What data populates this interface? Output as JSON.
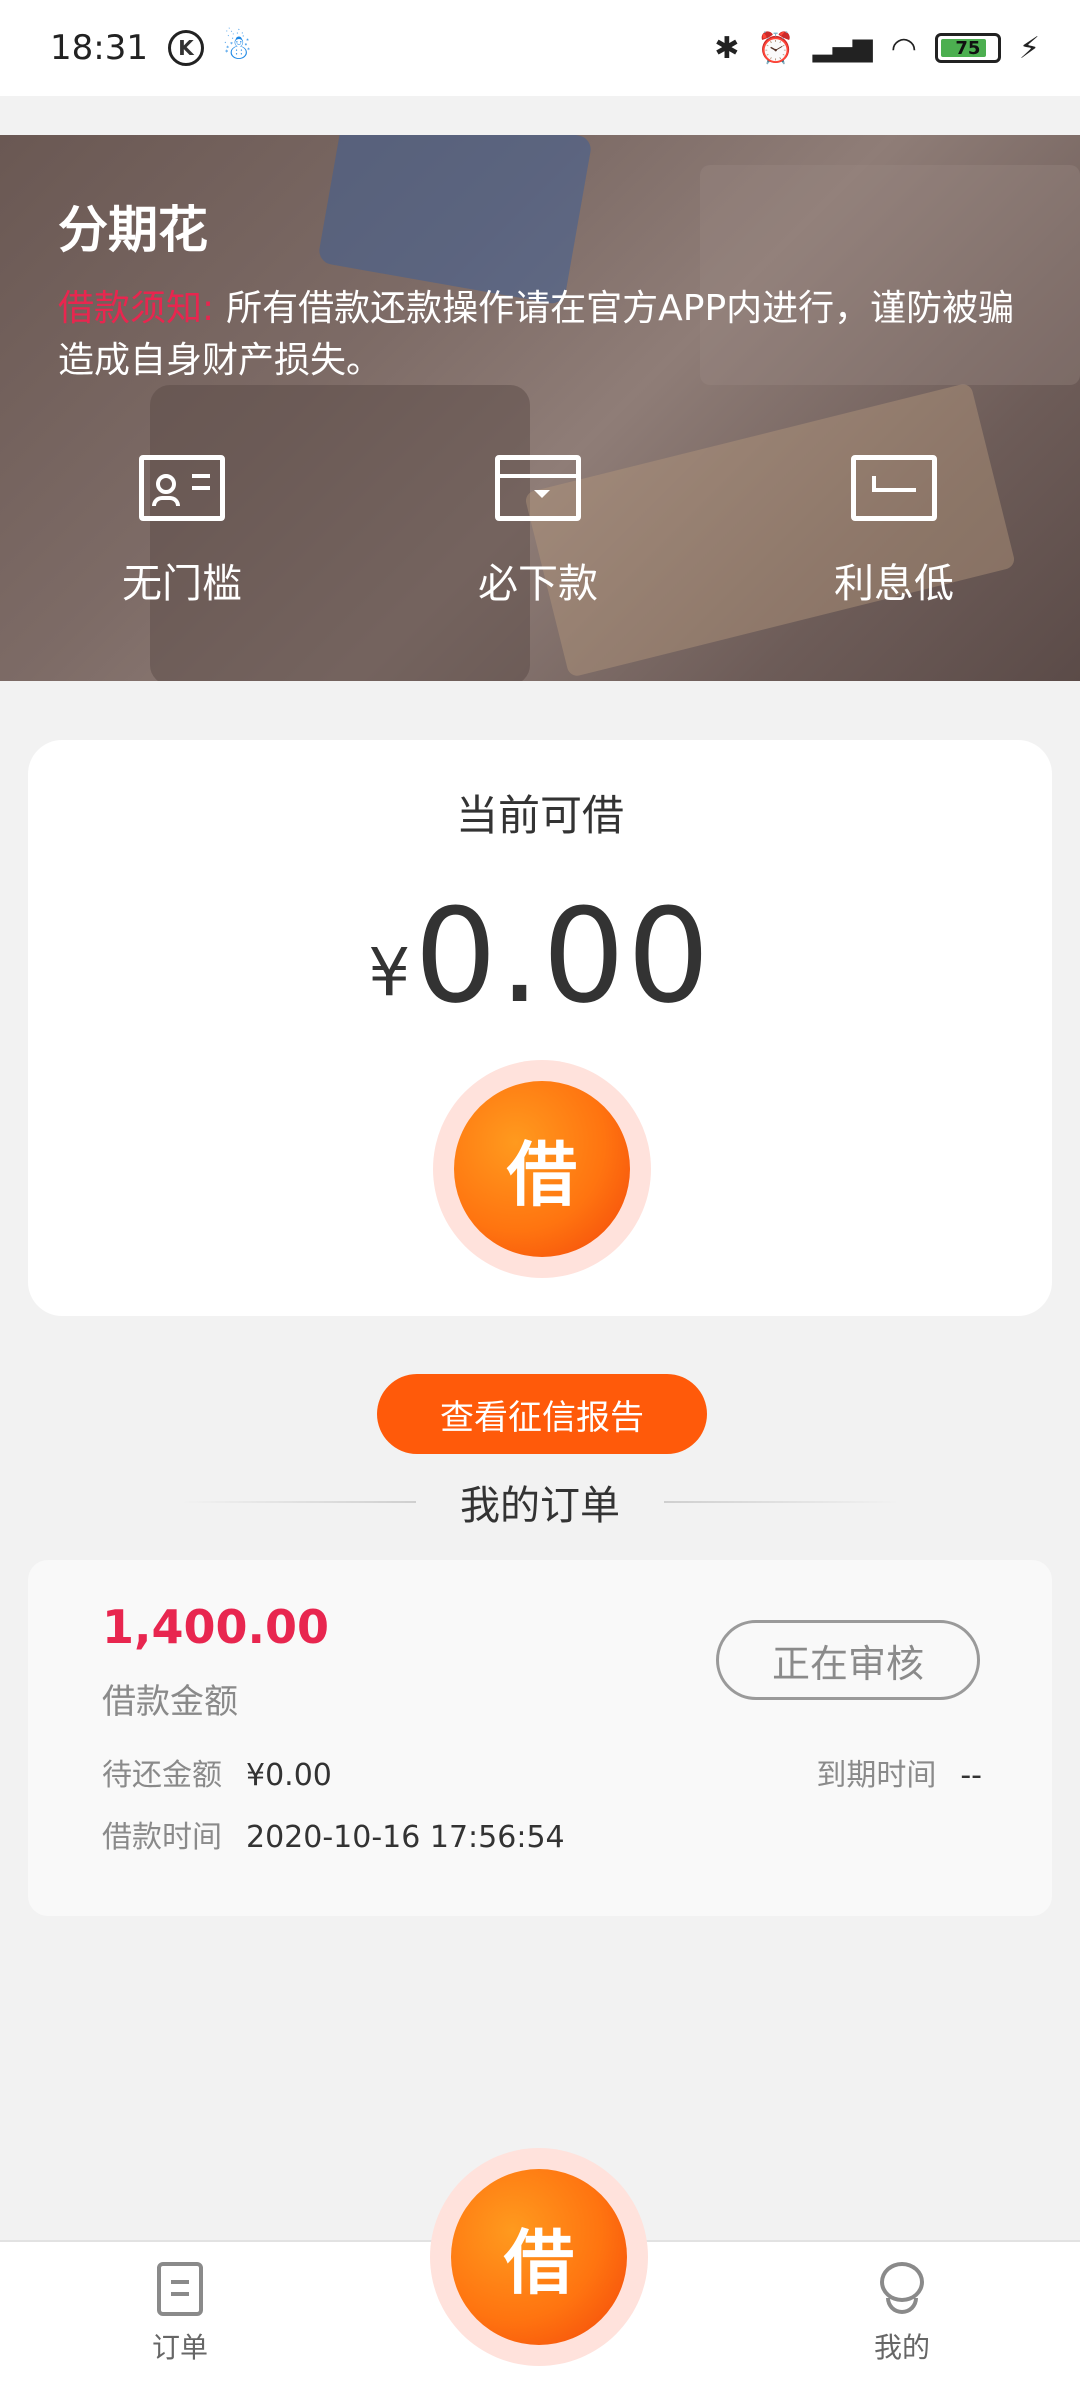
{
  "status_bar": {
    "time": "18:31",
    "battery": "75",
    "icons": [
      "k-icon",
      "qq-icon",
      "bluetooth-icon",
      "alarm-icon",
      "signal-icon",
      "wifi-icon",
      "battery-icon",
      "charging-icon"
    ]
  },
  "hero": {
    "title": "分期花",
    "notice_label": "借款须知:",
    "notice_text": "所有借款还款操作请在官方APP内进行，谨防被骗造成自身财产损失。",
    "features": [
      {
        "label": "无门槛",
        "icon": "id-card-icon"
      },
      {
        "label": "必下款",
        "icon": "wallet-icon"
      },
      {
        "label": "利息低",
        "icon": "return-arrow-icon"
      }
    ]
  },
  "card": {
    "title": "当前可借",
    "currency": "¥",
    "amount": "0.00",
    "borrow_label": "借"
  },
  "credit_report_label": "查看征信报告",
  "orders_heading": "我的订单",
  "order": {
    "amount": "1,400.00",
    "amount_label": "借款金额",
    "status": "正在审核",
    "pending_label": "待还金额",
    "pending_value": "¥0.00",
    "due_label": "到期时间",
    "due_value": "--",
    "borrow_time_label": "借款时间",
    "borrow_time_value": "2020-10-16 17:56:54"
  },
  "tabbar": {
    "orders_label": "订单",
    "center_label": "借",
    "mine_label": "我的"
  },
  "colors": {
    "accent": "#ff5a0a",
    "notice_red": "#e8264f",
    "amount_red": "#e8264f"
  }
}
